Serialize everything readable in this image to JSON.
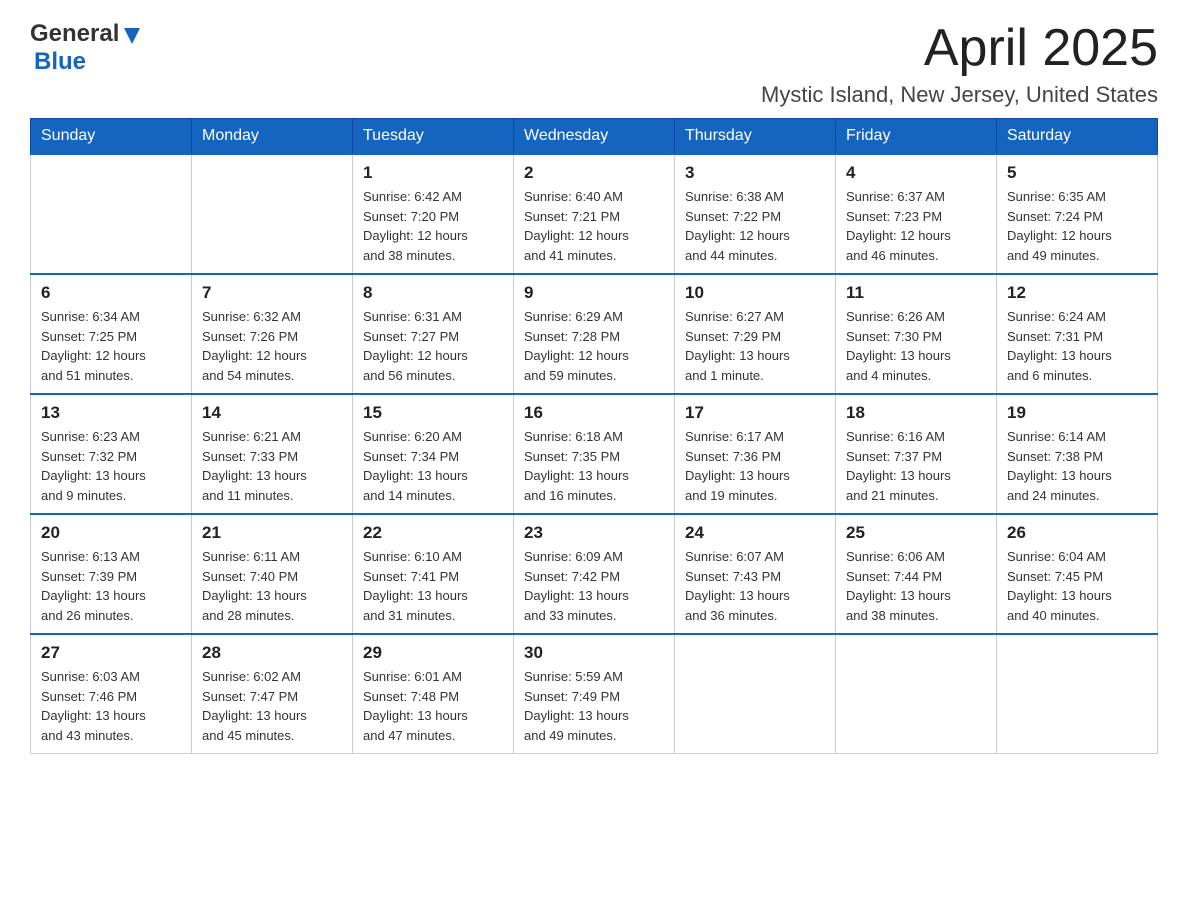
{
  "header": {
    "logo_general": "General",
    "logo_blue": "Blue",
    "month_year": "April 2025",
    "location": "Mystic Island, New Jersey, United States"
  },
  "days_of_week": [
    "Sunday",
    "Monday",
    "Tuesday",
    "Wednesday",
    "Thursday",
    "Friday",
    "Saturday"
  ],
  "weeks": [
    [
      {
        "day": "",
        "info": ""
      },
      {
        "day": "",
        "info": ""
      },
      {
        "day": "1",
        "info": "Sunrise: 6:42 AM\nSunset: 7:20 PM\nDaylight: 12 hours\nand 38 minutes."
      },
      {
        "day": "2",
        "info": "Sunrise: 6:40 AM\nSunset: 7:21 PM\nDaylight: 12 hours\nand 41 minutes."
      },
      {
        "day": "3",
        "info": "Sunrise: 6:38 AM\nSunset: 7:22 PM\nDaylight: 12 hours\nand 44 minutes."
      },
      {
        "day": "4",
        "info": "Sunrise: 6:37 AM\nSunset: 7:23 PM\nDaylight: 12 hours\nand 46 minutes."
      },
      {
        "day": "5",
        "info": "Sunrise: 6:35 AM\nSunset: 7:24 PM\nDaylight: 12 hours\nand 49 minutes."
      }
    ],
    [
      {
        "day": "6",
        "info": "Sunrise: 6:34 AM\nSunset: 7:25 PM\nDaylight: 12 hours\nand 51 minutes."
      },
      {
        "day": "7",
        "info": "Sunrise: 6:32 AM\nSunset: 7:26 PM\nDaylight: 12 hours\nand 54 minutes."
      },
      {
        "day": "8",
        "info": "Sunrise: 6:31 AM\nSunset: 7:27 PM\nDaylight: 12 hours\nand 56 minutes."
      },
      {
        "day": "9",
        "info": "Sunrise: 6:29 AM\nSunset: 7:28 PM\nDaylight: 12 hours\nand 59 minutes."
      },
      {
        "day": "10",
        "info": "Sunrise: 6:27 AM\nSunset: 7:29 PM\nDaylight: 13 hours\nand 1 minute."
      },
      {
        "day": "11",
        "info": "Sunrise: 6:26 AM\nSunset: 7:30 PM\nDaylight: 13 hours\nand 4 minutes."
      },
      {
        "day": "12",
        "info": "Sunrise: 6:24 AM\nSunset: 7:31 PM\nDaylight: 13 hours\nand 6 minutes."
      }
    ],
    [
      {
        "day": "13",
        "info": "Sunrise: 6:23 AM\nSunset: 7:32 PM\nDaylight: 13 hours\nand 9 minutes."
      },
      {
        "day": "14",
        "info": "Sunrise: 6:21 AM\nSunset: 7:33 PM\nDaylight: 13 hours\nand 11 minutes."
      },
      {
        "day": "15",
        "info": "Sunrise: 6:20 AM\nSunset: 7:34 PM\nDaylight: 13 hours\nand 14 minutes."
      },
      {
        "day": "16",
        "info": "Sunrise: 6:18 AM\nSunset: 7:35 PM\nDaylight: 13 hours\nand 16 minutes."
      },
      {
        "day": "17",
        "info": "Sunrise: 6:17 AM\nSunset: 7:36 PM\nDaylight: 13 hours\nand 19 minutes."
      },
      {
        "day": "18",
        "info": "Sunrise: 6:16 AM\nSunset: 7:37 PM\nDaylight: 13 hours\nand 21 minutes."
      },
      {
        "day": "19",
        "info": "Sunrise: 6:14 AM\nSunset: 7:38 PM\nDaylight: 13 hours\nand 24 minutes."
      }
    ],
    [
      {
        "day": "20",
        "info": "Sunrise: 6:13 AM\nSunset: 7:39 PM\nDaylight: 13 hours\nand 26 minutes."
      },
      {
        "day": "21",
        "info": "Sunrise: 6:11 AM\nSunset: 7:40 PM\nDaylight: 13 hours\nand 28 minutes."
      },
      {
        "day": "22",
        "info": "Sunrise: 6:10 AM\nSunset: 7:41 PM\nDaylight: 13 hours\nand 31 minutes."
      },
      {
        "day": "23",
        "info": "Sunrise: 6:09 AM\nSunset: 7:42 PM\nDaylight: 13 hours\nand 33 minutes."
      },
      {
        "day": "24",
        "info": "Sunrise: 6:07 AM\nSunset: 7:43 PM\nDaylight: 13 hours\nand 36 minutes."
      },
      {
        "day": "25",
        "info": "Sunrise: 6:06 AM\nSunset: 7:44 PM\nDaylight: 13 hours\nand 38 minutes."
      },
      {
        "day": "26",
        "info": "Sunrise: 6:04 AM\nSunset: 7:45 PM\nDaylight: 13 hours\nand 40 minutes."
      }
    ],
    [
      {
        "day": "27",
        "info": "Sunrise: 6:03 AM\nSunset: 7:46 PM\nDaylight: 13 hours\nand 43 minutes."
      },
      {
        "day": "28",
        "info": "Sunrise: 6:02 AM\nSunset: 7:47 PM\nDaylight: 13 hours\nand 45 minutes."
      },
      {
        "day": "29",
        "info": "Sunrise: 6:01 AM\nSunset: 7:48 PM\nDaylight: 13 hours\nand 47 minutes."
      },
      {
        "day": "30",
        "info": "Sunrise: 5:59 AM\nSunset: 7:49 PM\nDaylight: 13 hours\nand 49 minutes."
      },
      {
        "day": "",
        "info": ""
      },
      {
        "day": "",
        "info": ""
      },
      {
        "day": "",
        "info": ""
      }
    ]
  ]
}
